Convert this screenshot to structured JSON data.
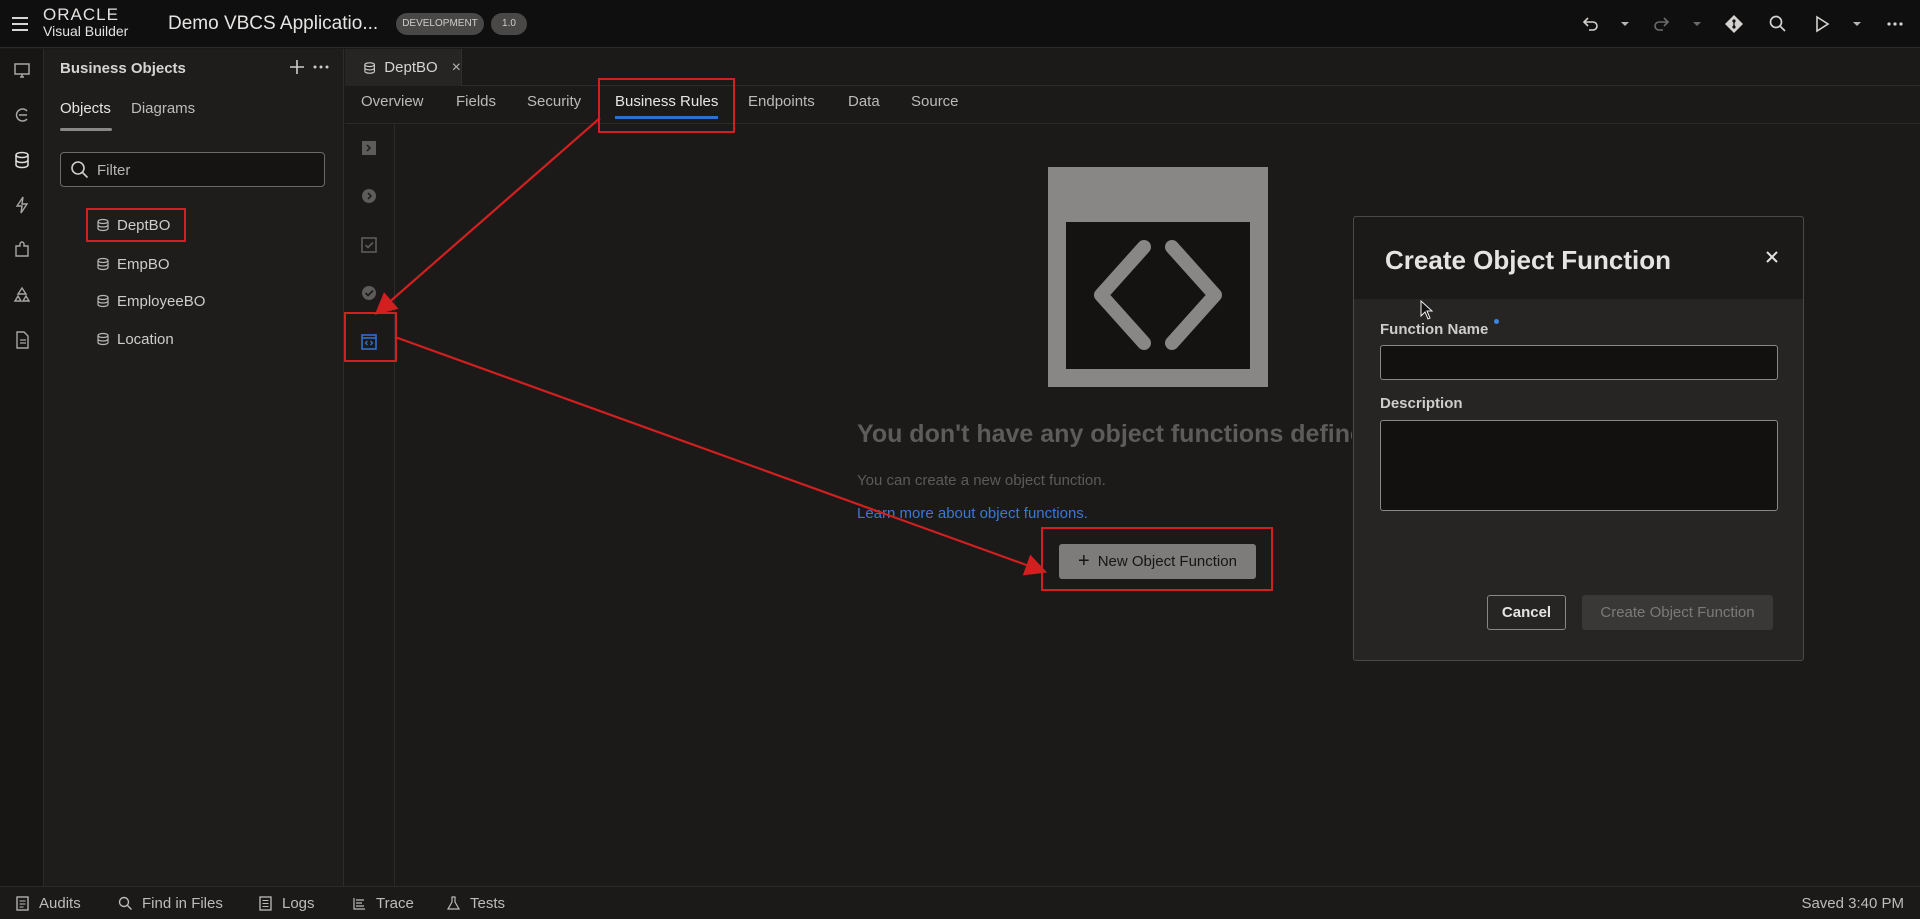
{
  "topbar": {
    "logo_oracle": "ORACLE",
    "logo_product": "Visual Builder",
    "app_title": "Demo VBCS Applicatio...",
    "env_badge": "DEVELOPMENT",
    "version_badge": "1.0"
  },
  "left_panel": {
    "title": "Business Objects",
    "tabs": [
      {
        "label": "Objects",
        "active": true
      },
      {
        "label": "Diagrams",
        "active": false
      }
    ],
    "filter_placeholder": "Filter",
    "items": [
      {
        "label": "DeptBO",
        "highlighted": true
      },
      {
        "label": "EmpBO"
      },
      {
        "label": "EmployeeBO"
      },
      {
        "label": "Location"
      }
    ]
  },
  "editor": {
    "tab_label": "DeptBO",
    "tab_close": "×",
    "subtabs": [
      {
        "label": "Overview"
      },
      {
        "label": "Fields"
      },
      {
        "label": "Security"
      },
      {
        "label": "Business Rules",
        "active": true
      },
      {
        "label": "Endpoints"
      },
      {
        "label": "Data"
      },
      {
        "label": "Source"
      }
    ]
  },
  "empty_state": {
    "title": "You don't have any object functions defined",
    "subtitle": "You can create a new object function.",
    "link": "Learn more about object functions.",
    "button": "New Object Function",
    "button_icon": "+"
  },
  "dialog": {
    "title": "Create Object Function",
    "function_name_label": "Function Name",
    "function_name_value": "",
    "description_label": "Description",
    "description_value": "",
    "cancel_label": "Cancel",
    "create_label": "Create Object Function"
  },
  "statusbar": {
    "items": [
      {
        "label": "Audits",
        "icon": "audit-icon"
      },
      {
        "label": "Find in Files",
        "icon": "search-icon"
      },
      {
        "label": "Logs",
        "icon": "logs-icon"
      },
      {
        "label": "Trace",
        "icon": "trace-icon"
      },
      {
        "label": "Tests",
        "icon": "flask-icon"
      }
    ],
    "saved": "Saved 3:40 PM"
  },
  "colors": {
    "accent": "#2f6fcf",
    "annotation": "#d21f1f",
    "link": "#3b78d4"
  }
}
